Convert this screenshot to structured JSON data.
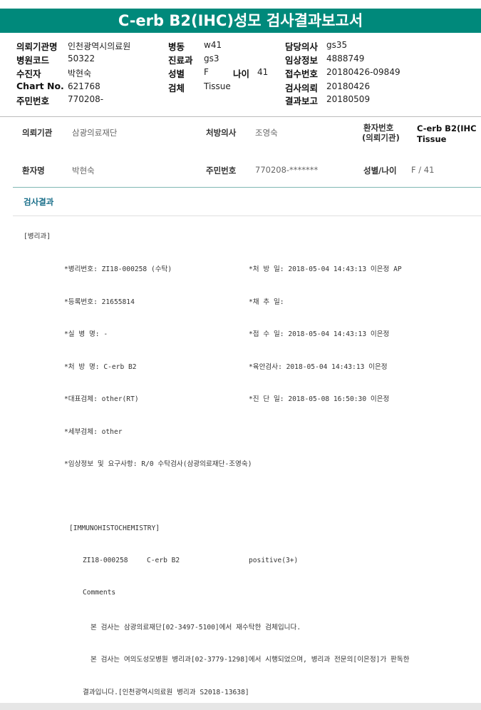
{
  "title": "C-erb B2(IHC)성모 검사결과보고서",
  "header": {
    "rows": [
      [
        {
          "label": "의뢰기관명",
          "value": "인천광역시의료원"
        },
        {
          "label": "병동",
          "value": "w41"
        },
        {
          "label": "담당의사",
          "value": "gs35"
        }
      ],
      [
        {
          "label": "병원코드",
          "value": "50322"
        },
        {
          "label": "진료과",
          "value": "gs3"
        },
        {
          "label": "임상정보",
          "value": "4888749"
        }
      ],
      [
        {
          "label": "수진자",
          "value": "박현숙"
        },
        {
          "label": "성별",
          "value": "F"
        },
        {
          "label": "접수번호",
          "value": "20180426-09849"
        }
      ],
      [
        {
          "label": "Chart No.",
          "value": "621768"
        },
        {
          "label": "검체",
          "value": "Tissue"
        },
        {
          "label": "검사의뢰",
          "value": "20180426"
        }
      ],
      [
        {
          "label": "주민번호",
          "value": "770208-"
        },
        {
          "label": "",
          "value": ""
        },
        {
          "label": "결과보고",
          "value": "20180509"
        }
      ]
    ],
    "age_label": "나이",
    "age_value": "41"
  },
  "patient": {
    "institution_label": "의뢰기관",
    "institution_value": "삼광의료재단",
    "doctor_label": "처방의사",
    "doctor_value": "조영숙",
    "patno_label_1": "환자번호",
    "patno_label_2": "(의뢰기관)",
    "patno_value_1": "C-erb B2(IHC",
    "patno_value_2": "Tissue",
    "name_label": "환자명",
    "name_value": "박현숙",
    "rrn_label": "주민번호",
    "rrn_value": "770208-*******",
    "sexage_label": "성별/나이",
    "sexage_value": "F / 41"
  },
  "results": {
    "section_title": "검사결과",
    "dept": "[병리과]",
    "left_fields": [
      "*병리번호: ZI18-000258 (수탁)",
      "*등록번호: 21655814",
      "*실 병 명: -",
      "*처 방 명: C-erb B2",
      "*대표검체: other(RT)",
      "*세부검체: other",
      "*임상정보 및 요구사항: R/0 수탁검사(삼광의료재단-조영숙)"
    ],
    "right_fields": [
      "*처 방 일: 2018-05-04 14:43:13  이은정 AP",
      "*채 추 일:",
      "*접 수 일: 2018-05-04 14:43:13  이은정",
      "*육안검사: 2018-05-04 14:43:13  이은정",
      "*진 단 일: 2018-05-08 16:50:30  이은정"
    ],
    "ihc_header": "[IMMUNOHISTOCHEMISTRY]",
    "ihc_no": "ZI18-000258",
    "ihc_test": "C-erb B2",
    "ihc_result": "positive(3+)",
    "comments_label": "Comments",
    "comment_1": "본 검사는 삼광의료재단[02-3497-5100]에서 재수탁한 검체입니다.",
    "comment_2": "본 검사는 여의도성모병원 병리과[02-3779-1298]에서 시행되었으며, 병리과 전문의[이은정]가 판독한",
    "comment_3": "결과입니다.[인천광역시의료원 병리과  S2018-13638]"
  },
  "colors": {
    "title_bar": "#00897b",
    "section_title": "#1a6f8a"
  }
}
